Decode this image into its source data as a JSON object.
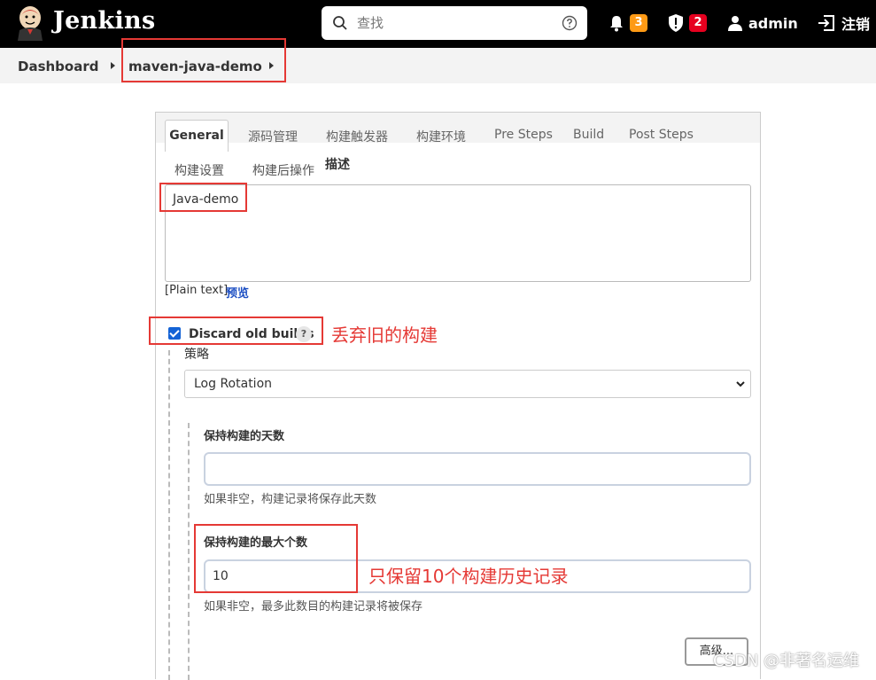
{
  "header": {
    "brand": "Jenkins",
    "search_placeholder": "查找",
    "notifications_count": "3",
    "security_count": "2",
    "user": "admin",
    "logout": "注销"
  },
  "breadcrumb": {
    "items": [
      "Dashboard",
      "maven-java-demo"
    ]
  },
  "tabs": {
    "row1": [
      "General",
      "源码管理",
      "构建触发器",
      "构建环境",
      "Pre Steps",
      "Build",
      "Post Steps"
    ],
    "row2": [
      "构建设置",
      "构建后操作"
    ]
  },
  "description": {
    "label": "描述",
    "value": "Java-demo",
    "plain_text": "[Plain text]",
    "preview": "预览"
  },
  "discard": {
    "label": "Discard old builds",
    "help": "?",
    "checked": true,
    "annotation": "丢弃旧的构建"
  },
  "strategy": {
    "label": "策略",
    "selected": "Log Rotation"
  },
  "days_to_keep": {
    "label": "保持构建的天数",
    "value": "",
    "hint": "如果非空，构建记录将保存此天数"
  },
  "max_builds": {
    "label": "保持构建的最大个数",
    "value": "10",
    "hint": "如果非空，最多此数目的构建记录将被保存",
    "annotation": "只保留10个构建历史记录"
  },
  "advanced_button": "高级...",
  "watermark": "CSDN @非著名运维",
  "colors": {
    "header_bg": "#000000",
    "accent_blue": "#1463d6",
    "annotation_red": "#e53935",
    "badge_orange": "#fe9a15",
    "badge_red": "#e6001f"
  }
}
